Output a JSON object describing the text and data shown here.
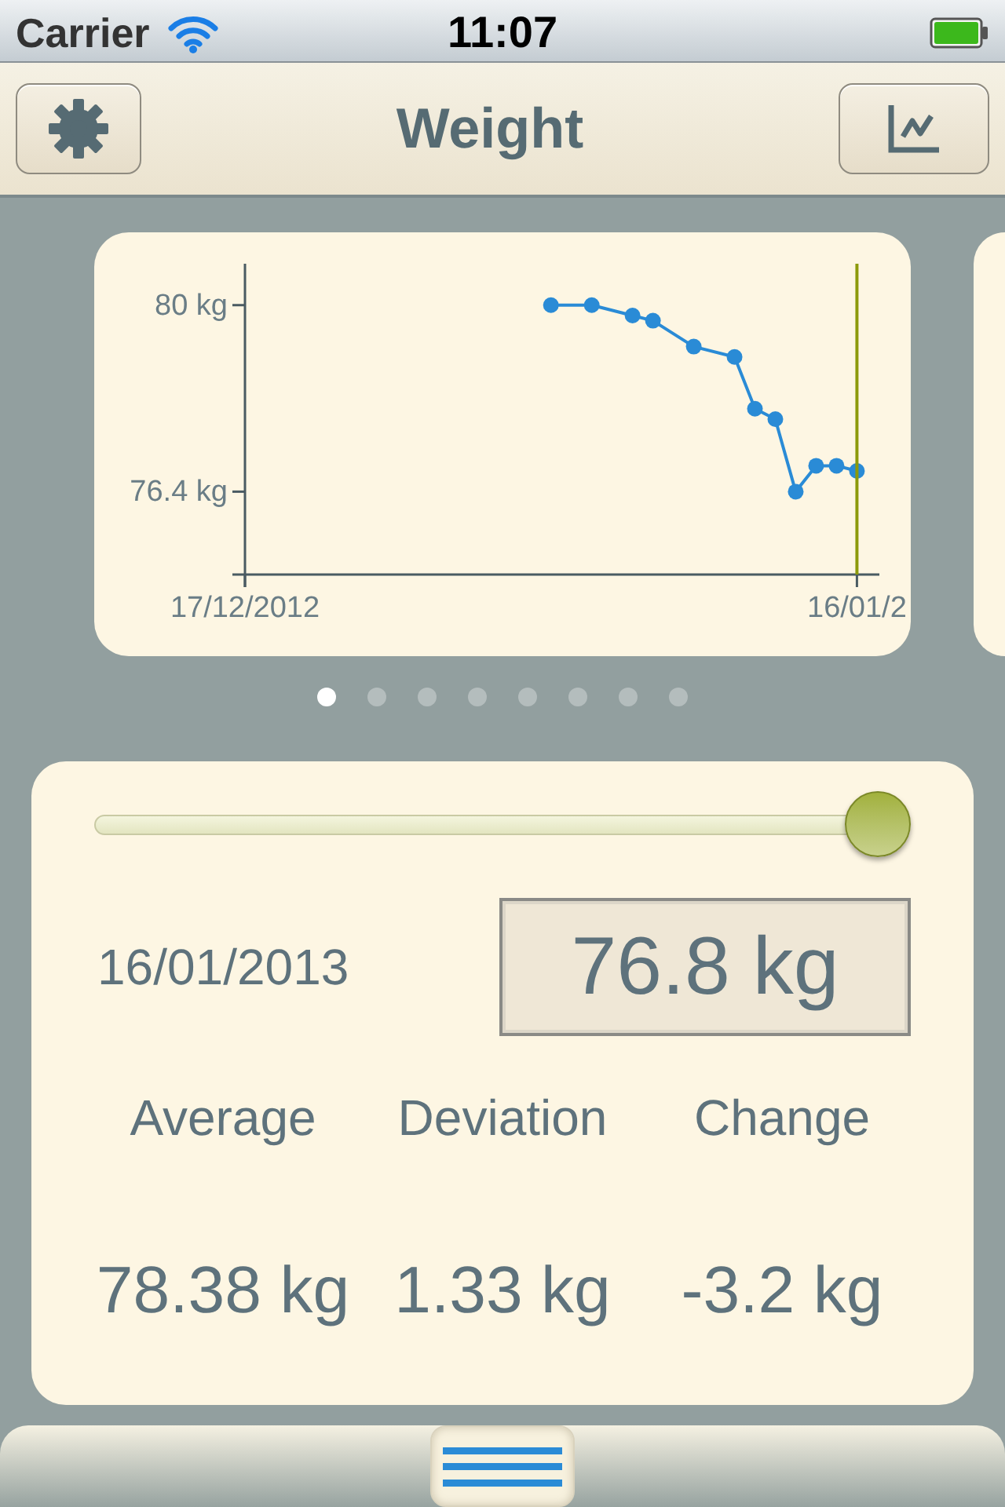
{
  "status_bar": {
    "carrier": "Carrier",
    "time": "11:07"
  },
  "nav_bar": {
    "title": "Weight"
  },
  "chart_card": {
    "chart_data": {
      "type": "line",
      "categories": [
        "17/12/2012",
        null,
        null,
        null,
        null,
        null,
        null,
        null,
        null,
        null,
        null,
        null,
        null,
        null,
        null,
        null,
        null,
        null,
        null,
        null,
        null,
        null,
        null,
        null,
        null,
        null,
        null,
        null,
        null,
        null,
        "16/01/2"
      ],
      "series": [
        {
          "color": "#2a8bd6",
          "marker": "circle",
          "values": [
            null,
            null,
            null,
            null,
            null,
            null,
            null,
            null,
            null,
            null,
            null,
            null,
            null,
            null,
            null,
            80,
            null,
            80,
            null,
            79.8,
            79.7,
            null,
            79.2,
            null,
            79.0,
            78.0,
            77.8,
            76.4,
            76.9,
            76.9,
            76.8
          ]
        }
      ],
      "ylim": [
        74.8,
        80.8
      ],
      "yticks": [
        {
          "value": 80,
          "label": "80 kg"
        },
        {
          "value": 76.4,
          "label": "76.4 kg"
        }
      ]
    }
  },
  "pages": [
    {
      "selected": true
    },
    {
      "selected": false
    },
    {
      "selected": false
    },
    {
      "selected": false
    },
    {
      "selected": false
    },
    {
      "selected": false
    },
    {
      "selected": false
    },
    {
      "selected": false
    }
  ],
  "detail": {
    "slider": {
      "level": 1
    },
    "date": "16/01/2013",
    "weight": "76.8 kg",
    "stats": [
      {
        "label": "Average",
        "value": "78.38 kg"
      },
      {
        "label": "Deviation",
        "value": "1.33 kg"
      },
      {
        "label": "Change",
        "value": "-3.2 kg"
      }
    ]
  }
}
